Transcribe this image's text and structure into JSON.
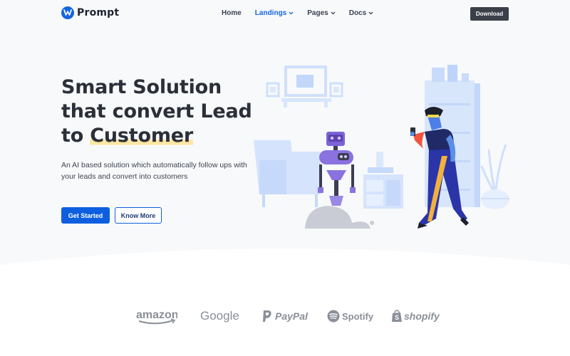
{
  "brand": {
    "name": "Prompt",
    "mark_icon": "prompt-logo-icon",
    "accent": "#1565e0"
  },
  "nav": {
    "items": [
      {
        "label": "Home",
        "active": false,
        "dropdown": false
      },
      {
        "label": "Landings",
        "active": true,
        "dropdown": true
      },
      {
        "label": "Pages",
        "active": false,
        "dropdown": true
      },
      {
        "label": "Docs",
        "active": false,
        "dropdown": true
      }
    ],
    "download_label": "Download"
  },
  "hero": {
    "headline_line1": "Smart Solution",
    "headline_line2": "that convert Lead",
    "headline_line3_prefix": "to ",
    "headline_line3_highlight": "Customer",
    "subtext": "An AI based solution which automatically follow ups with your leads and convert into customers",
    "primary_cta": "Get Started",
    "secondary_cta": "Know More",
    "highlight_color": "#fde6a4",
    "button_color": "#0d5fe0"
  },
  "logos": [
    {
      "name": "amazon",
      "icon": "amazon-logo-icon"
    },
    {
      "name": "Google",
      "icon": "google-logo-icon"
    },
    {
      "name": "PayPal",
      "icon": "paypal-logo-icon"
    },
    {
      "name": "Spotify",
      "icon": "spotify-logo-icon"
    },
    {
      "name": "shopify",
      "icon": "shopify-logo-icon"
    }
  ]
}
